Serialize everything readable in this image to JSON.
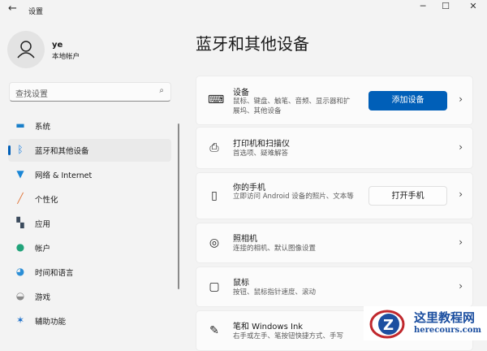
{
  "titlebar": {
    "title": "设置",
    "back": "←",
    "minimize": "─",
    "maximize": "☐",
    "close": "✕"
  },
  "user": {
    "name": "ye",
    "type": "本地帐户"
  },
  "search": {
    "placeholder": "查找设置"
  },
  "nav": [
    {
      "label": "系统",
      "icon": "monitor-icon",
      "color": "#1a7fc9"
    },
    {
      "label": "蓝牙和其他设备",
      "icon": "bluetooth-icon",
      "color": "#1a7fe0"
    },
    {
      "label": "网络 & Internet",
      "icon": "wifi-icon",
      "color": "#1a86d6"
    },
    {
      "label": "个性化",
      "icon": "brush-icon",
      "color": "#e0763a"
    },
    {
      "label": "应用",
      "icon": "apps-icon",
      "color": "#3a4a5c"
    },
    {
      "label": "帐户",
      "icon": "account-icon",
      "color": "#21a37a"
    },
    {
      "label": "时间和语言",
      "icon": "globe-clock-icon",
      "color": "#2b8ed6"
    },
    {
      "label": "游戏",
      "icon": "gamepad-icon",
      "color": "#8a8a8a"
    },
    {
      "label": "辅助功能",
      "icon": "accessibility-icon",
      "color": "#1a6ec9"
    }
  ],
  "page_title": "蓝牙和其他设备",
  "cards": [
    {
      "title": "设备",
      "desc": "鼠标、键盘、触笔、音频、显示器和扩展坞、其他设备",
      "button": "添加设备"
    },
    {
      "title": "打印机和扫描仪",
      "desc": "首选项、疑难解答"
    },
    {
      "title": "你的手机",
      "desc": "立即访问 Android 设备的照片、文本等",
      "button": "打开手机"
    },
    {
      "title": "照相机",
      "desc": "连接的相机、默认图像设置"
    },
    {
      "title": "鼠标",
      "desc": "按钮、鼠标指针速度、滚动"
    },
    {
      "title": "笔和 Windows Ink",
      "desc": "右手或左手、笔按钮快捷方式、手写"
    }
  ],
  "watermark": {
    "name": "这里教程网",
    "url": "herecours.com"
  }
}
